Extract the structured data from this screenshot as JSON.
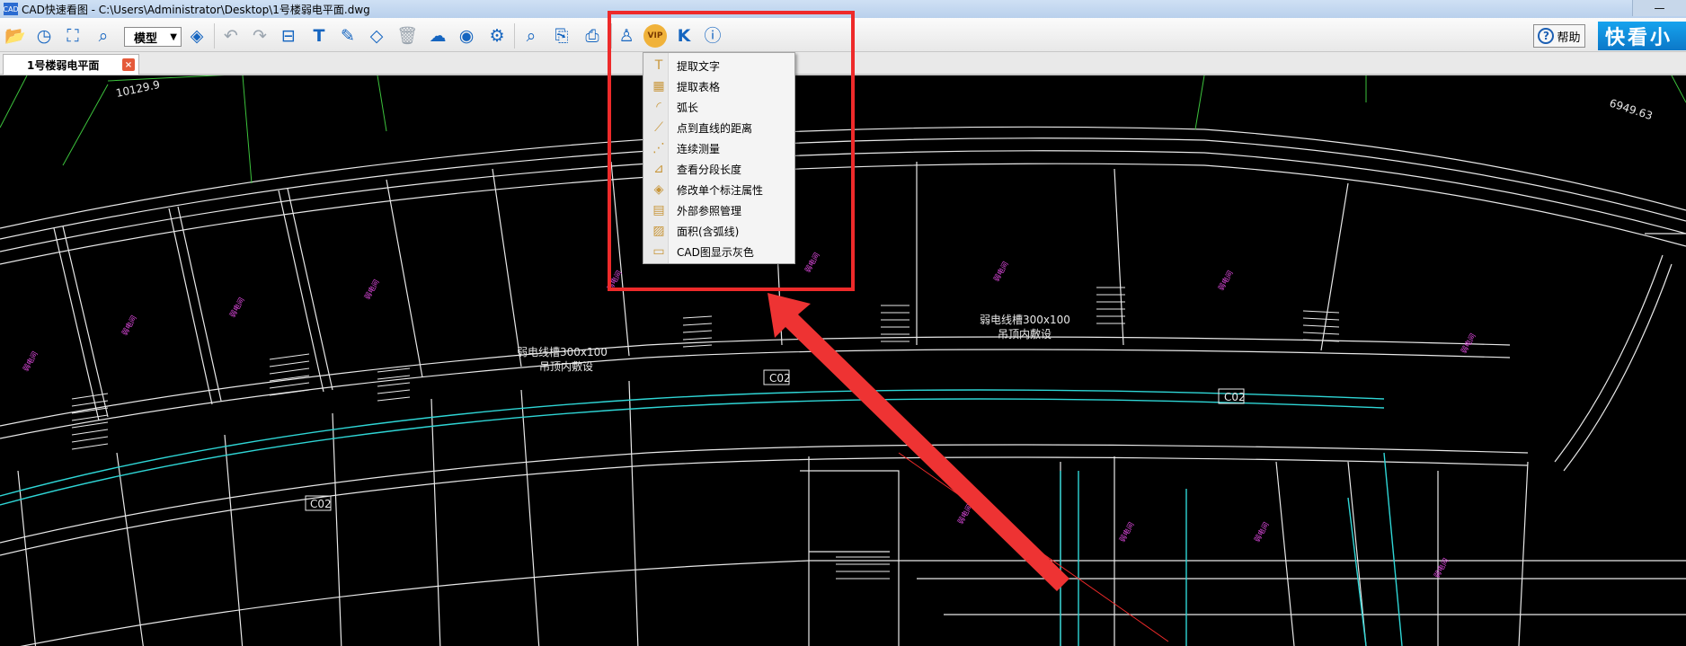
{
  "window": {
    "title": "CAD快速看图 - C:\\Users\\Administrator\\Desktop\\1号楼弱电平面.dwg",
    "app_icon": "cad-icon",
    "minimize_label": "—"
  },
  "toolbar": {
    "model_select": "模型",
    "help_label": "帮助",
    "brand_label": "快看小",
    "icons": [
      "open-folder-icon",
      "history-icon",
      "fit-extent-icon",
      "zoom-window-icon",
      "layer-icon",
      "undo-icon",
      "redo-icon",
      "measure-icon",
      "text-icon",
      "markup-pen-icon",
      "eraser-icon",
      "delete-icon",
      "cloud-icon",
      "hide-icon",
      "settings-icon",
      "find-text-icon",
      "export-icon",
      "print-icon",
      "user-icon",
      "vip-icon",
      "k-tools-icon",
      "info-icon"
    ]
  },
  "tab": {
    "label": "1号楼弱电平面",
    "close": "×"
  },
  "menu": {
    "items": [
      {
        "label": "提取文字",
        "icon": "extract-text-icon"
      },
      {
        "label": "提取表格",
        "icon": "extract-table-icon"
      },
      {
        "label": "弧长",
        "icon": "arc-length-icon"
      },
      {
        "label": "点到直线的距离",
        "icon": "point-line-distance-icon"
      },
      {
        "label": "连续测量",
        "icon": "continuous-measure-icon"
      },
      {
        "label": "查看分段长度",
        "icon": "segment-length-icon"
      },
      {
        "label": "修改单个标注属性",
        "icon": "edit-dimension-icon"
      },
      {
        "label": "外部参照管理",
        "icon": "xref-manager-icon"
      },
      {
        "label": "面积(含弧线)",
        "icon": "area-icon"
      },
      {
        "label": "CAD图显示灰色",
        "icon": "gray-display-icon"
      }
    ]
  },
  "drawing": {
    "labels": {
      "dim1": "10129.9",
      "dim2": "6949.63",
      "cable1_line1": "弱电线槽300x100",
      "cable1_line2": "吊顶内敷设",
      "cable2_line1": "弱电线槽300x100",
      "cable2_line2": "吊顶内敷设",
      "c02_a": "C02",
      "c02_b": "C02",
      "c02_c": "C02"
    },
    "colors": {
      "lines": "#e8e8e8",
      "green": "#3cc23c",
      "cyan": "#2fd6d6",
      "magenta": "#e04ae0",
      "red": "#ee2a2a"
    }
  }
}
